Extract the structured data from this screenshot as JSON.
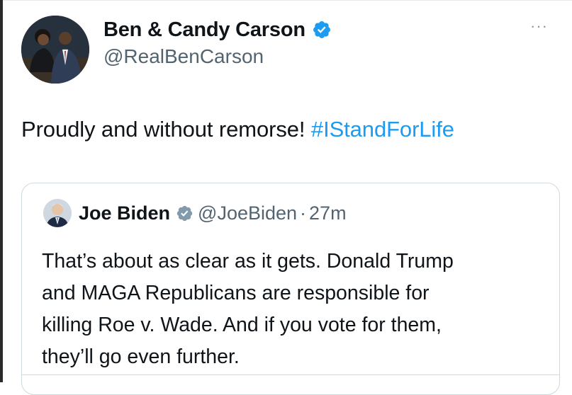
{
  "author": {
    "display_name": "Ben & Candy Carson",
    "handle": "@RealBenCarson",
    "verified_badge": "blue-check-icon",
    "avatar": "couple-photo"
  },
  "more_menu": "···",
  "tweet": {
    "text": "Proudly and without remorse! ",
    "hashtag": "#IStandForLife"
  },
  "quoted": {
    "display_name": "Joe Biden",
    "verified_badge": "gray-check-icon",
    "handle": "@JoeBiden",
    "separator": "·",
    "time": "27m",
    "lines": [
      "That’s about as clear as it gets. Donald Trump",
      "and MAGA Republicans are responsible for",
      "killing Roe v. Wade. And if you vote for them,",
      "they’ll go even further."
    ]
  },
  "colors": {
    "text": "#0f1419",
    "secondary": "#536471",
    "link": "#1d9bf0",
    "border": "#cfd9de",
    "verified_blue": "#1d9bf0",
    "verified_gray": "#829aab"
  }
}
